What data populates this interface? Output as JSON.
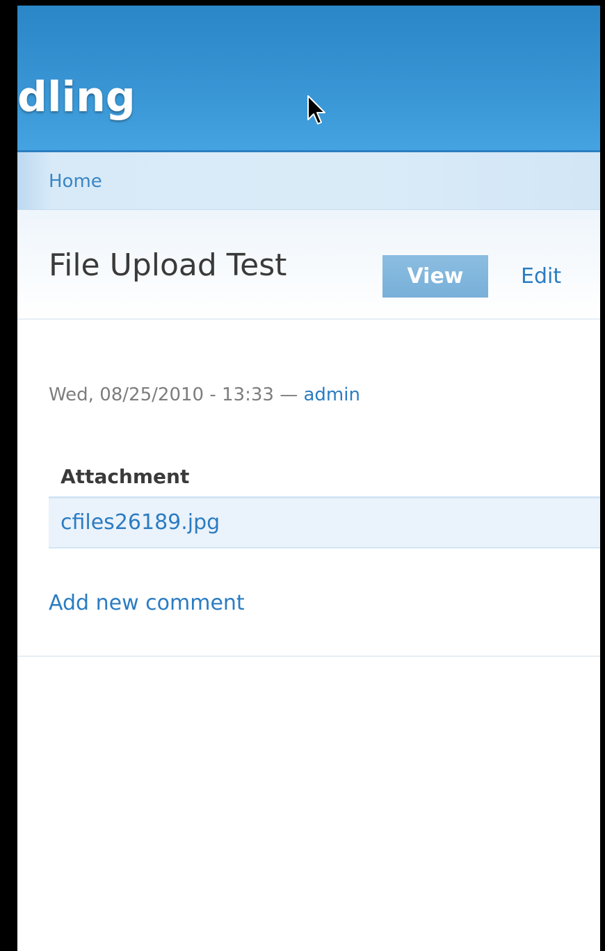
{
  "header": {
    "site_name": "dling",
    "brand_color": "#3894d3"
  },
  "breadcrumb": {
    "home": "Home"
  },
  "node": {
    "title": "File Upload Test",
    "tabs": {
      "view": "View",
      "edit": "Edit"
    },
    "meta": {
      "date": "Wed, 08/25/2010 - 13:33",
      "separator": "—",
      "author": "admin"
    },
    "attachments": {
      "header": "Attachment",
      "files": [
        "cfiles26189.jpg"
      ]
    },
    "links": {
      "add_comment": "Add new comment"
    }
  },
  "colors": {
    "link": "#2b7cc2",
    "active_tab": "#80b6dc",
    "breadcrumb_bg": "#d8eaf8"
  }
}
